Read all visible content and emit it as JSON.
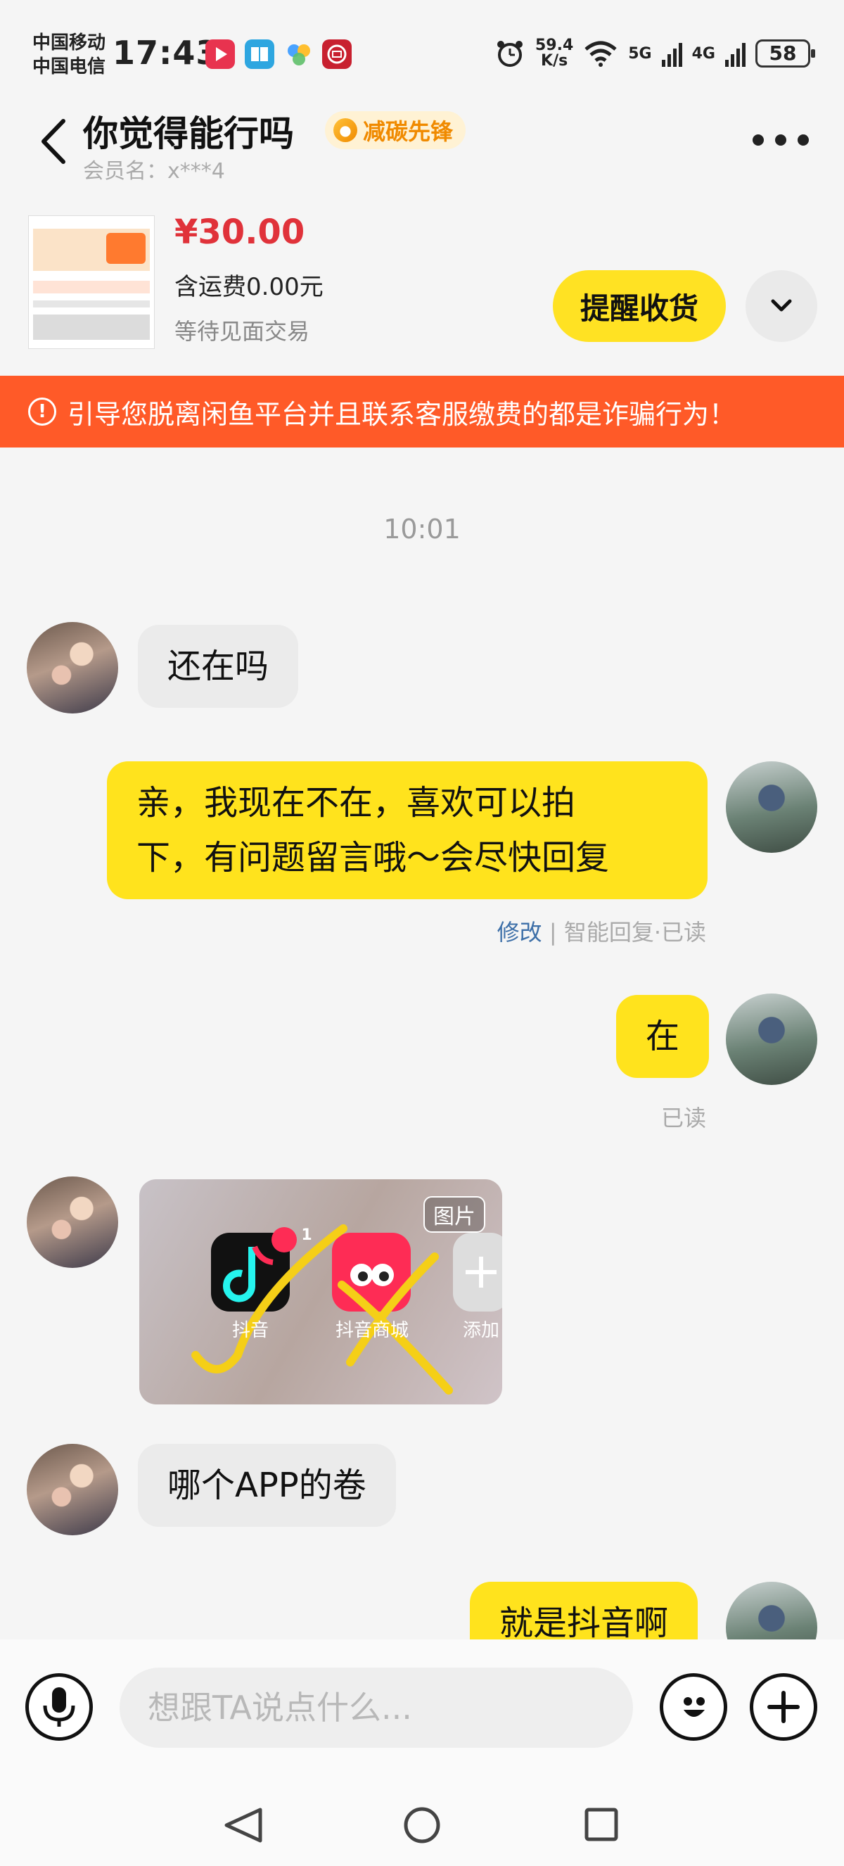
{
  "status_bar": {
    "carrier1": "中国移动",
    "carrier2": "中国电信",
    "time": "17:43",
    "net_speed_value": "59.4",
    "net_speed_unit": "K/s",
    "net1": "5G",
    "net2": "4G",
    "battery": "58"
  },
  "header": {
    "title": "你觉得能行吗",
    "badge": "减碳先锋",
    "member": "会员名：x***4"
  },
  "product": {
    "price": "¥30.00",
    "shipping": "含运费0.00元",
    "status": "等待见面交易",
    "remind_button": "提醒收货"
  },
  "warning": {
    "text": "引导您脱离闲鱼平台并且联系客服缴费的都是诈骗行为！"
  },
  "chat": {
    "timestamp": "10:01",
    "messages": [
      {
        "side": "in",
        "text": "还在吗"
      },
      {
        "side": "out",
        "line1": "亲，我现在不在，喜欢可以拍",
        "line2": "下，有问题留言哦～会尽快回复",
        "edit": "修改",
        "meta": "智能回复·已读"
      },
      {
        "side": "out",
        "text": "在",
        "meta": "已读"
      },
      {
        "side": "in",
        "type": "image",
        "tag": "图片",
        "app1_badge": "1",
        "app1_label": "抖音",
        "app2_label": "抖音商城",
        "app3_label": "添加"
      },
      {
        "side": "in",
        "text": "哪个APP的卷"
      },
      {
        "side": "out",
        "text": "就是抖音啊"
      }
    ]
  },
  "input": {
    "placeholder": "想跟TA说点什么..."
  },
  "colors": {
    "accent_yellow": "#ffe223",
    "warning_orange": "#ff5a28",
    "price_red": "#e0323a"
  }
}
